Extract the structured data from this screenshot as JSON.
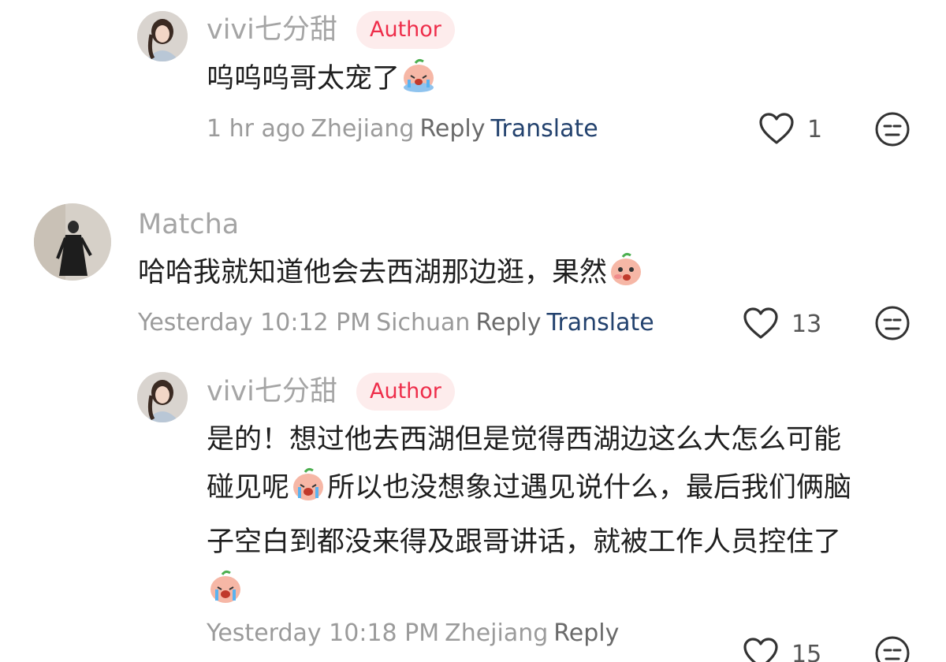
{
  "comments": [
    {
      "username": "vivi七分甜",
      "badge": "Author",
      "text_before": "呜呜呜哥太宠了",
      "emoji": "crying-face-emoji",
      "time": "1 hr ago",
      "location": "Zhejiang",
      "reply_label": "Reply",
      "translate_label": "Translate",
      "like_count": "1"
    },
    {
      "username": "Matcha",
      "text_before": "哈哈我就知道他会去西湖那边逛，果然",
      "emoji": "smirking-face-emoji",
      "time": "Yesterday 10:12 PM",
      "location": "Sichuan",
      "reply_label": "Reply",
      "translate_label": "Translate",
      "like_count": "13"
    },
    {
      "username": "vivi七分甜",
      "badge": "Author",
      "line1": "是的！想过他去西湖但是觉得西湖边这么大怎么可能",
      "line2_before": "碰见呢",
      "line2_after": "所以也没想象过遇见说什么，最后我们俩脑",
      "line3": "子空白到都没来得及跟哥讲话，就被工作人员控住了",
      "time": "Yesterday 10:18 PM",
      "location": "Zhejiang",
      "reply_label": "Reply",
      "like_count": "15"
    }
  ],
  "colors": {
    "author_badge_bg": "#fdecec",
    "author_badge_text": "#ee2d4a",
    "translate_link": "#23426e",
    "username": "#a5a5a5",
    "meta": "#9b9b9b"
  },
  "icons": [
    "heart-outline-icon",
    "neutral-face-icon"
  ]
}
